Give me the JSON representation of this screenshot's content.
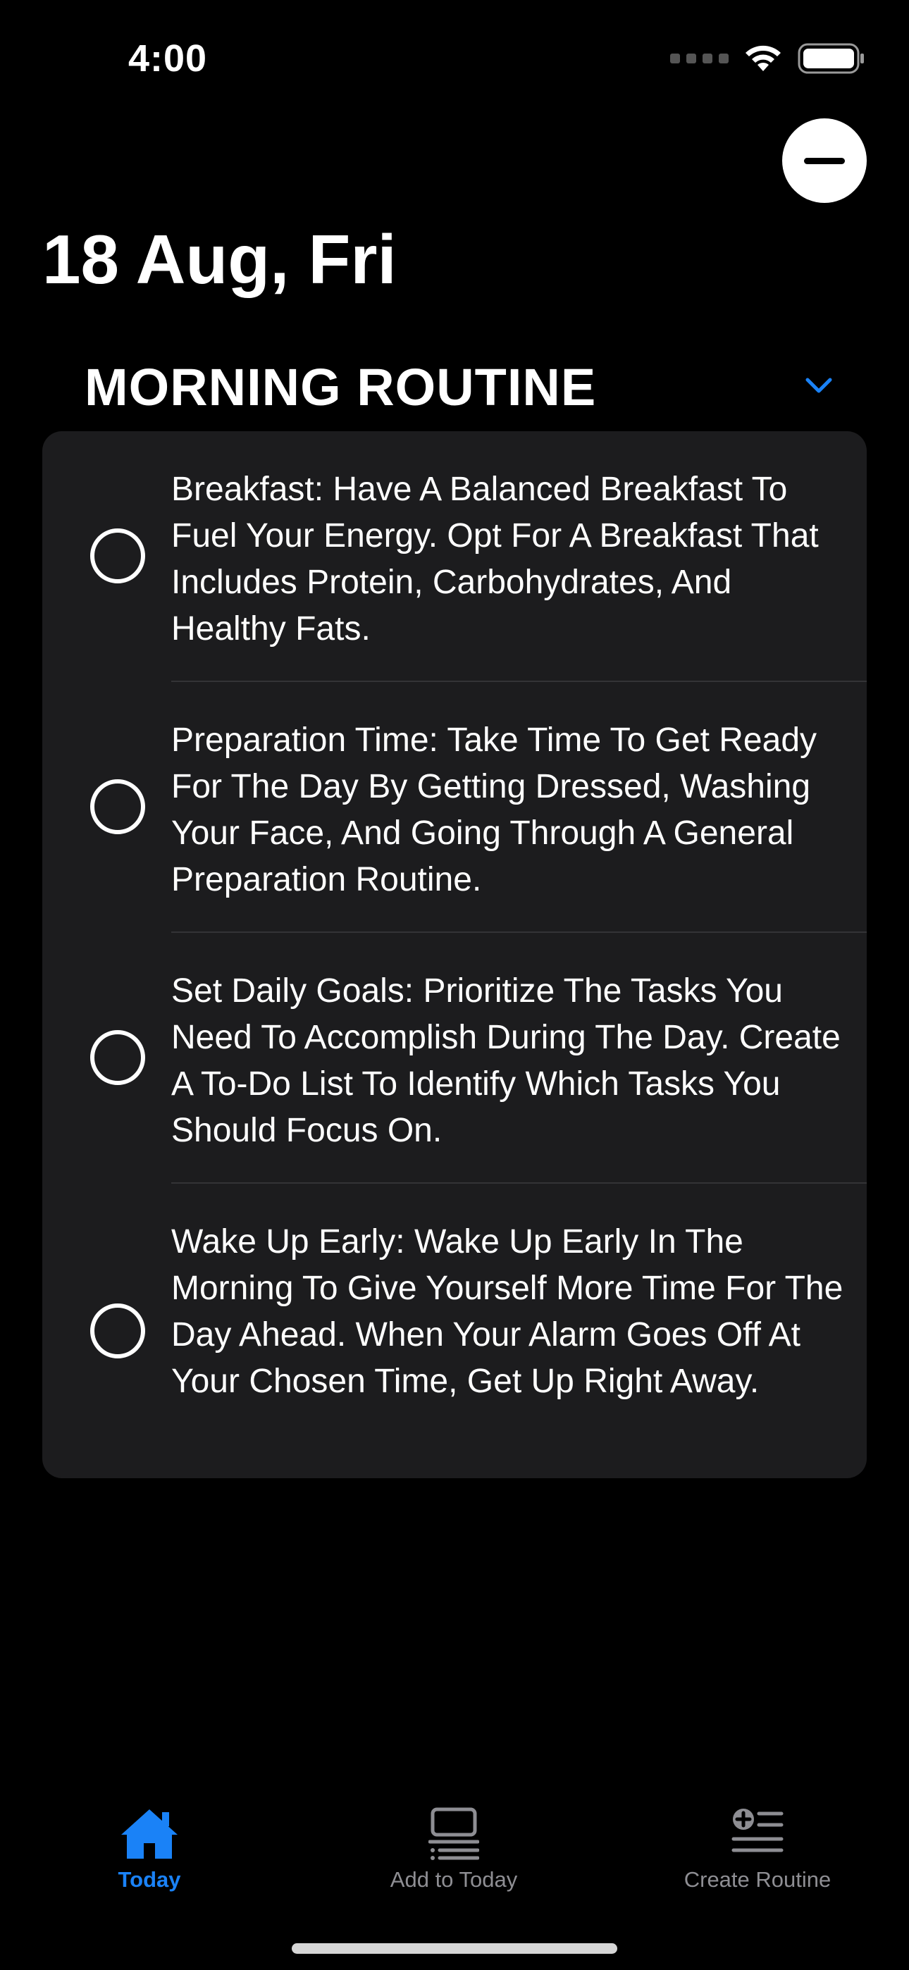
{
  "status_bar": {
    "time": "4:00"
  },
  "header": {
    "date_title": "18 Aug, Fri"
  },
  "section": {
    "title": "MORNING ROUTINE",
    "tasks": [
      {
        "text": "Breakfast: Have A Balanced Breakfast To Fuel Your Energy. Opt For A Breakfast That Includes Protein, Carbohydrates, And Healthy Fats.",
        "done": false
      },
      {
        "text": "Preparation Time: Take Time To Get Ready For The Day By Getting Dressed, Washing Your Face, And Going Through A General Preparation Routine.",
        "done": false
      },
      {
        "text": "Set Daily Goals: Prioritize The Tasks You Need To Accomplish During The Day. Create A To-Do List To Identify Which Tasks You Should Focus On.",
        "done": false
      },
      {
        "text": "Wake Up Early: Wake Up Early In The Morning To Give Yourself More Time For The Day Ahead. When Your Alarm Goes Off At Your Chosen Time, Get Up Right Away.",
        "done": false
      }
    ]
  },
  "tab_bar": {
    "tabs": [
      {
        "label": "Today",
        "icon": "house-fill-icon",
        "selected": true
      },
      {
        "label": "Add to Today",
        "icon": "list-laptop-icon",
        "selected": false
      },
      {
        "label": "Create Routine",
        "icon": "plus-list-icon",
        "selected": false
      }
    ]
  },
  "colors": {
    "background": "#000000",
    "card": "#1c1c1e",
    "accent": "#1a82f7",
    "inactive": "#8e8e93"
  }
}
